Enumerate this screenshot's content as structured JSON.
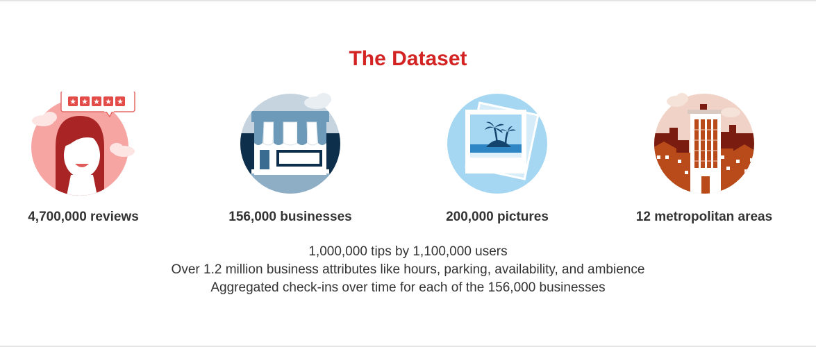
{
  "section": {
    "title": "The Dataset"
  },
  "stats": {
    "reviews": {
      "label": "4,700,000 reviews",
      "icon": "reviewer-avatar-icon",
      "rating_stars": 5
    },
    "businesses": {
      "label": "156,000 businesses",
      "icon": "storefront-icon"
    },
    "pictures": {
      "label": "200,000 pictures",
      "icon": "photos-icon"
    },
    "metro": {
      "label": "12 metropolitan areas",
      "icon": "city-skyline-icon"
    }
  },
  "details": [
    "1,000,000 tips by 1,100,000 users",
    "Over 1.2 million business attributes like hours, parking, availability, and ambience",
    "Aggregated check-ins over time for each of the 156,000 businesses"
  ],
  "colors": {
    "title": "#d32323",
    "text": "#333333"
  }
}
